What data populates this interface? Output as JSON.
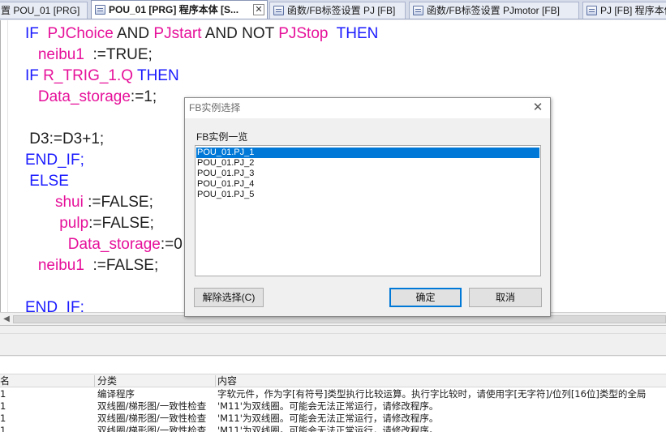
{
  "tabs": [
    {
      "label": "置 POU_01 [PRG]",
      "icon": "none",
      "active": false
    },
    {
      "label": "POU_01 [PRG] 程序本体 [S...",
      "icon": "program-icon",
      "active": true
    },
    {
      "label": "函数/FB标签设置 PJ [FB]",
      "icon": "label-table-icon",
      "active": false
    },
    {
      "label": "函数/FB标签设置 PJmotor [FB]",
      "icon": "label-table-icon",
      "active": false
    },
    {
      "label": "PJ [FB] 程序本体",
      "icon": "program-icon",
      "active": false
    }
  ],
  "tab_close_symbol": "✕",
  "code_lines": [
    [
      {
        "t": "IF  ",
        "c": "kw"
      },
      {
        "t": "PJChoice",
        "c": "pk"
      },
      {
        "t": " AND ",
        "c": ""
      },
      {
        "t": "PJstart",
        "c": "pk"
      },
      {
        "t": " AND NOT ",
        "c": ""
      },
      {
        "t": "PJStop",
        "c": "pk"
      },
      {
        "t": "  THEN",
        "c": "kw"
      }
    ],
    [
      {
        "t": "   ",
        "c": ""
      },
      {
        "t": "neibu1",
        "c": "pk"
      },
      {
        "t": "  :=TRUE;",
        "c": ""
      }
    ],
    [
      {
        "t": "IF ",
        "c": "kw"
      },
      {
        "t": "R_TRIG_1.Q",
        "c": "pk"
      },
      {
        "t": " THEN",
        "c": "kw"
      }
    ],
    [
      {
        "t": "   ",
        "c": ""
      },
      {
        "t": "Data_storage",
        "c": "pk"
      },
      {
        "t": ":=1;",
        "c": ""
      }
    ],
    [],
    [
      {
        "t": " D3:=D3+1;",
        "c": ""
      }
    ],
    [
      {
        "t": "END_IF;",
        "c": "kw"
      }
    ],
    [
      {
        "t": " ELSE",
        "c": "kw"
      }
    ],
    [
      {
        "t": "       ",
        "c": ""
      },
      {
        "t": "shui",
        "c": "pk"
      },
      {
        "t": " :=FALSE;",
        "c": ""
      }
    ],
    [
      {
        "t": "        ",
        "c": ""
      },
      {
        "t": "pulp",
        "c": "pk"
      },
      {
        "t": ":=FALSE;",
        "c": ""
      }
    ],
    [
      {
        "t": "          ",
        "c": ""
      },
      {
        "t": "Data_storage",
        "c": "pk"
      },
      {
        "t": ":=0",
        "c": ""
      }
    ],
    [
      {
        "t": "   ",
        "c": ""
      },
      {
        "t": "neibu1",
        "c": "pk"
      },
      {
        "t": "  :=FALSE;",
        "c": ""
      }
    ],
    [],
    [
      {
        "t": "END_IF;",
        "c": "kw"
      }
    ]
  ],
  "dialog": {
    "title": "FB实例选择",
    "close_icon": "✕",
    "list_label": "FB实例一览",
    "instances": [
      "POU_01.PJ_1",
      "POU_01.PJ_2",
      "POU_01.PJ_3",
      "POU_01.PJ_4",
      "POU_01.PJ_5"
    ],
    "selected_index": 0,
    "deselect_button": "解除选择(C)",
    "ok_button": "确定",
    "cancel_button": "取消"
  },
  "output": {
    "headers": [
      "名",
      "分类",
      "内容"
    ],
    "rows": [
      [
        "1",
        "编译程序",
        "字软元件，作为字[有符号]类型执行比较运算。执行字比较时，请使用字[无字符]/位列[16位]类型的全局"
      ],
      [
        "1",
        "双线圈/梯形图/一致性检查",
        "'M11'为双线圈。可能会无法正常运行，请修改程序。"
      ],
      [
        "1",
        "双线圈/梯形图/一致性检查",
        "'M11'为双线圈。可能会无法正常运行，请修改程序。"
      ],
      [
        "1",
        "双线圈/梯形图/一致性检查",
        "'M11'为双线圈。可能会无法正常运行，请修改程序。"
      ]
    ]
  },
  "colors": {
    "keyword": "#1a1aff",
    "variable": "#e6109a",
    "selection": "#0078d7"
  }
}
